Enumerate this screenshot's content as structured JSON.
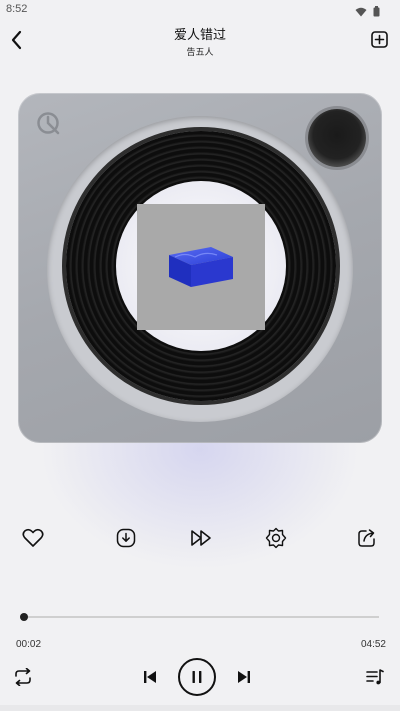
{
  "status_bar": {
    "time": "8:52",
    "icons": [
      "wifi-icon",
      "battery-icon"
    ]
  },
  "header": {
    "title": "爱人错过",
    "artist": "告五人",
    "back_icon": "chevron-left-icon",
    "add_icon": "add-to-playlist-icon"
  },
  "player": {
    "style": "vinyl-turntable",
    "cover_art": "blue-cube-on-gray"
  },
  "actions": [
    {
      "name": "like-button",
      "icon": "heart-icon"
    },
    {
      "name": "download-button",
      "icon": "download-icon"
    },
    {
      "name": "speed-button",
      "icon": "fast-forward-icon"
    },
    {
      "name": "sound-effect-button",
      "icon": "gear-icon"
    },
    {
      "name": "share-button",
      "icon": "share-icon"
    }
  ],
  "progress": {
    "current": "00:02",
    "total": "04:52",
    "fraction": 0.007
  },
  "controls": {
    "repeat_icon": "repeat-icon",
    "prev_icon": "skip-previous-icon",
    "play_state_icon": "pause-icon",
    "next_icon": "skip-next-icon",
    "playlist_icon": "playlist-icon"
  },
  "colors": {
    "background": "#f1f1f3",
    "accent": "#111111",
    "device": "#a9acb2"
  }
}
